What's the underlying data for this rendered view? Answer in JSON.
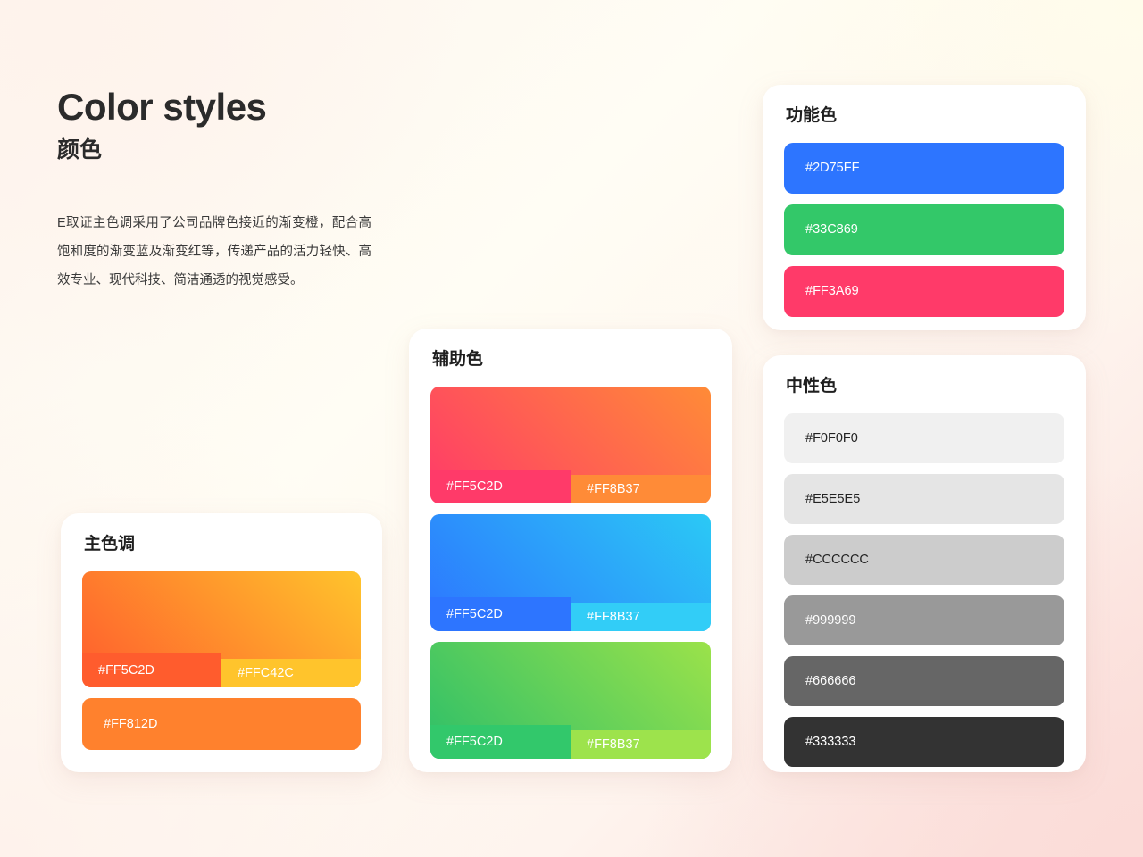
{
  "background": {
    "top_left": "#FDF4EE",
    "top_right": "#FFFCEB",
    "bottom_right": "#FBDCD8"
  },
  "intro": {
    "title_en": "Color styles",
    "title_cn": "颜色",
    "body": "E取证主色调采用了公司品牌色接近的渐变橙，配合高饱和度的渐变蓝及渐变红等，传递产品的活力轻快、高效专业、现代科技、简洁通透的视觉感受。"
  },
  "primary": {
    "title": "主色调",
    "gradient": {
      "from": "#FF5C2D",
      "to": "#FFC42C",
      "left_label": "#FF5C2D",
      "right_label": "#FFC42C"
    },
    "solid": {
      "hex": "#FF812D",
      "label": "#FF812D"
    }
  },
  "auxiliary": {
    "title": "辅助色",
    "swatches": [
      {
        "from": "#FF3A69",
        "to": "#FF8B37",
        "left_label": "#FF5C2D",
        "right_label": "#FF8B37",
        "left_chip": "#FF3A69",
        "right_chip": "#FF8B37"
      },
      {
        "from": "#2D75FF",
        "to": "#2BC9F5",
        "left_label": "#FF5C2D",
        "right_label": "#FF8B37",
        "left_chip": "#2D75FF",
        "right_chip": "#32CDF7"
      },
      {
        "from": "#2DBF69",
        "to": "#9BE24A",
        "left_label": "#FF5C2D",
        "right_label": "#FF8B37",
        "left_chip": "#32C86B",
        "right_chip": "#9DE34C"
      }
    ]
  },
  "functional": {
    "title": "功能色",
    "swatches": [
      {
        "hex": "#2D75FF",
        "label": "#2D75FF",
        "text": "#FFFFFF"
      },
      {
        "hex": "#33C869",
        "label": "#33C869",
        "text": "#FFFFFF"
      },
      {
        "hex": "#FF3A69",
        "label": "#FF3A69",
        "text": "#FFFFFF"
      }
    ]
  },
  "neutral": {
    "title": "中性色",
    "swatches": [
      {
        "hex": "#F0F0F0",
        "label": "#F0F0F0",
        "text": "#222222"
      },
      {
        "hex": "#E5E5E5",
        "label": "#E5E5E5",
        "text": "#222222"
      },
      {
        "hex": "#CCCCCC",
        "label": "#CCCCCC",
        "text": "#222222"
      },
      {
        "hex": "#999999",
        "label": "#999999",
        "text": "#FFFFFF"
      },
      {
        "hex": "#666666",
        "label": "#666666",
        "text": "#FFFFFF"
      },
      {
        "hex": "#333333",
        "label": "#333333",
        "text": "#FFFFFF"
      }
    ]
  }
}
